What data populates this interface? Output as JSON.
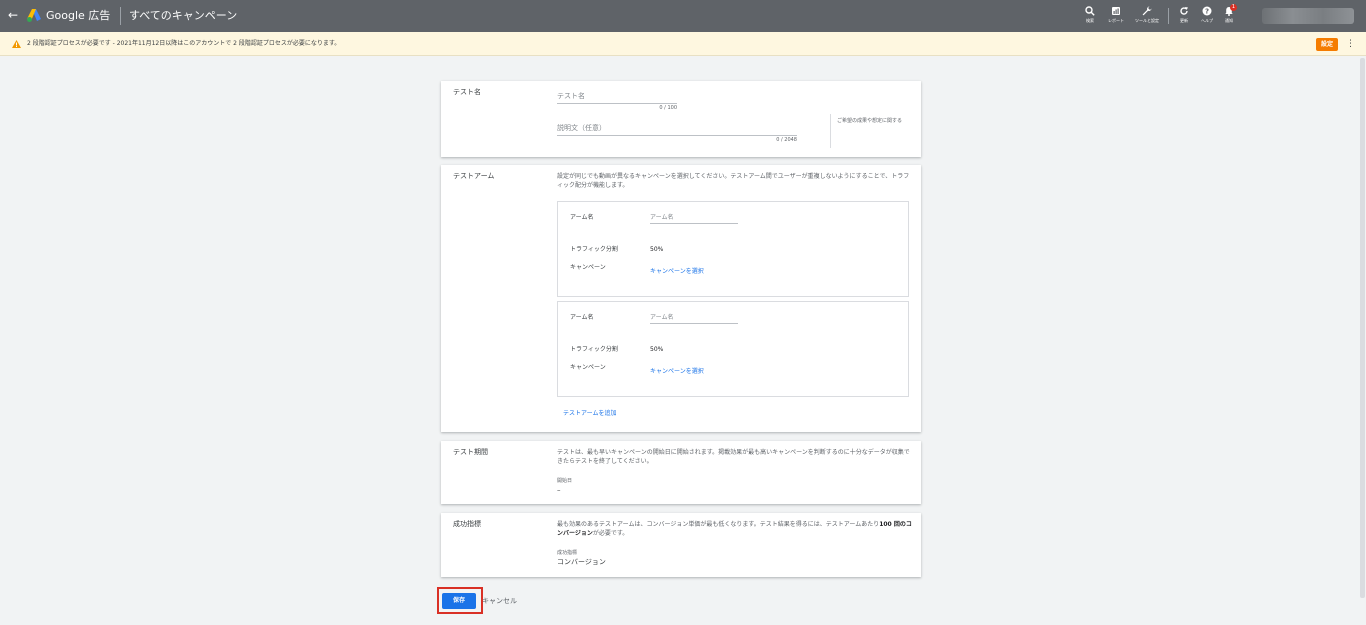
{
  "topbar": {
    "brand": "Google 広告",
    "page_title": "すべてのキャンペーン",
    "tools": [
      {
        "icon": "search-icon",
        "label": "検索"
      },
      {
        "icon": "report-icon",
        "label": "レポート"
      },
      {
        "icon": "wrench-icon",
        "label": "ツールと設定"
      },
      {
        "icon": "refresh-icon",
        "label": "更新"
      },
      {
        "icon": "help-icon",
        "label": "ヘルプ"
      },
      {
        "icon": "bell-icon",
        "label": "通知"
      }
    ],
    "notification_badge": "1"
  },
  "alert": {
    "text": "2 段階認証プロセスが必要です - 2021年11月12日以降はこのアカウントで 2 段階認証プロセスが必要になります。",
    "action_label": "設定",
    "more_label": "⋮"
  },
  "test_name_card": {
    "label": "テスト名",
    "name_placeholder": "テスト名",
    "name_counter": "0 / 100",
    "desc_placeholder": "説明文（任意）",
    "desc_counter": "0 / 2048",
    "side_note": "ご希望の成果や想定に関する"
  },
  "test_arms_card": {
    "label": "テストアーム",
    "description": "設定が同じでも動画が異なるキャンペーンを選択してください。テストアーム間でユーザーが重複しないようにすることで、トラフィック配分が機能します。",
    "arms": [
      {
        "name_label": "アーム名",
        "name_placeholder": "アーム名",
        "traffic_label": "トラフィック分割",
        "traffic_value": "50%",
        "campaign_label": "キャンペーン",
        "campaign_link": "キャンペーンを選択"
      },
      {
        "name_label": "アーム名",
        "name_placeholder": "アーム名",
        "traffic_label": "トラフィック分割",
        "traffic_value": "50%",
        "campaign_label": "キャンペーン",
        "campaign_link": "キャンペーンを選択"
      }
    ],
    "add_arm_link": "テストアームを追加"
  },
  "test_period_card": {
    "label": "テスト期間",
    "description": "テストは、最も早いキャンペーンの開始日に開始されます。掲載効果が最も高いキャンペーンを判断するのに十分なデータが収集できたらテストを終了してください。",
    "start_label": "開始日",
    "start_value": "–"
  },
  "success_card": {
    "label": "成功指標",
    "description_pre": "最も効果のあるテストアームは、コンバージョン単価が最も低くなります。テスト結果を得るには、テストアームあたり",
    "description_bold": "100 回のコンバージョン",
    "description_post": "が必要です。",
    "metric_label": "成功指標",
    "metric_value": "コンバージョン"
  },
  "footer": {
    "save_label": "保存",
    "cancel_label": "キャンセル"
  }
}
